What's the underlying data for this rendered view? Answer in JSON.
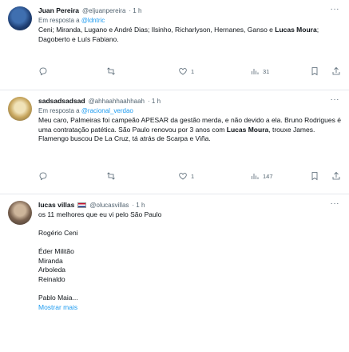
{
  "tweets": [
    {
      "name": "Juan Pereira",
      "handle": "@eljuanpereira",
      "time": "· 1 h",
      "reply_prefix": "Em resposta a ",
      "reply_to": "@ldntric",
      "text_parts": [
        "Ceni; Miranda, Lugano e André Dias; Ilsinho, Richarlyson, Hernanes, Ganso e ",
        "Lucas Moura",
        "; Dagoberto e Luís Fabiano."
      ],
      "replies": "",
      "retweets": "",
      "likes": "1",
      "views": "31"
    },
    {
      "name": "sadsadsadsad",
      "handle": "@ahhaahhaahhaah",
      "time": "· 1 h",
      "reply_prefix": "Em resposta a ",
      "reply_to": "@racional_verdao",
      "text_parts": [
        "Meu caro, Palmeiras foi campeão APESAR da gestão merda, e não devido a ela. Bruno Rodrigues é uma contratação patética. São Paulo renovou por 3 anos com ",
        "Lucas Moura",
        ", trouxe James. Flamengo buscou De La Cruz, tá atrás de Scarpa e Viña."
      ],
      "replies": "",
      "retweets": "",
      "likes": "1",
      "views": "147"
    },
    {
      "name": "lucas villas",
      "flag": "flag-icon",
      "handle": "@olucasvillas",
      "time": "· 1 h",
      "lines": [
        "os 11 melhores que eu vi pelo São Paulo",
        "",
        "Rogério Ceni",
        "",
        "Éder Militão",
        "Miranda",
        "Arboleda",
        "Reinaldo",
        "",
        "Pablo Maia..."
      ],
      "show_more": "Mostrar mais"
    }
  ],
  "colors": {
    "accent": "#1d9bf0",
    "secondary_text": "#536471",
    "divider": "#e6e9ec"
  }
}
